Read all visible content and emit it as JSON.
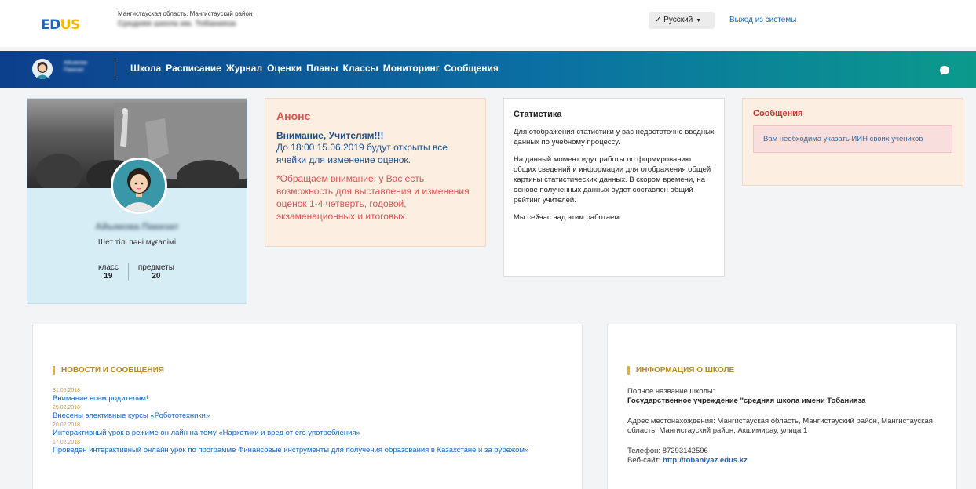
{
  "header": {
    "logo_e": "ED",
    "logo_us": "US",
    "region": "Мангистауская область, Мангистауский район",
    "school_name": "Средняя школа им. Тобанияза",
    "language": "✓ Русский",
    "logout": "Выход из системы"
  },
  "nav": {
    "user_line1": "Айымова",
    "user_line2": "Пакизат",
    "items": [
      "Школа",
      "Расписание",
      "Журнал",
      "Оценки",
      "Планы",
      "Классы",
      "Мониторинг",
      "Сообщения"
    ]
  },
  "profile": {
    "name": "Айымова Пакизат",
    "role": "Шет тілі пәні мұғалімі",
    "class_label": "класс",
    "class_value": "19",
    "subjects_label": "предметы",
    "subjects_value": "20"
  },
  "announcement": {
    "title": "Анонс",
    "attention": "Внимание, Учителям!!!",
    "text1": "До 18:00 15.06.2019 будут открыты все ячейки для изменение оценок.",
    "text2": "*Обращаем внимание, у Вас есть возможность для выставления и изменения оценок 1-4 четверть, годовой, экзаменационных и итоговых."
  },
  "statistics": {
    "title": "Статистика",
    "p1": "Для отображения статистики у вас недостаточно вводных данных по учебному процессу.",
    "p2": "На данный момент идут работы по формированию общих сведений и информации для отображения общей картины статистических данных. В скором времени, на основе полученных данных будет составлен общий рейтинг учителей.",
    "p3": "Мы сейчас над этим работаем."
  },
  "messages": {
    "title": "Сообщения",
    "alert": "Вам необходима указать ИИН своих учеников"
  },
  "news": {
    "title": "НОВОСТИ И СООБЩЕНИЯ",
    "items": [
      {
        "date": "31.05.2018",
        "title": "Внимание всем родителям!"
      },
      {
        "date": "25.02.2018",
        "title": "Внесены элективные курсы «Робототехники»"
      },
      {
        "date": "20.02.2018",
        "title": "Интерактивный урок в режиме он лайн на тему «Наркотики и вред от его употребления»"
      },
      {
        "date": "17.02.2018",
        "title": "Проведен интерактивный онлайн урок по программе Финансовые инструменты для получения образования в Казахстане и за рубежом»"
      }
    ]
  },
  "school_info": {
    "title": "ИНФОРМАЦИЯ О ШКОЛЕ",
    "fullname_label": "Полное название школы:",
    "fullname_value": "Государственное учреждение \"средняя школа имени Тобанияза",
    "address": "Адрес местонахождения: Мангистауская область, Мангистауский район, Мангистауская область, Мангистауский район, Акшимирау, улица 1",
    "phone": "Телефон: 87293142596",
    "website_label": "Веб-сайт: ",
    "website_value": "http://tobaniyaz.edus.kz"
  }
}
